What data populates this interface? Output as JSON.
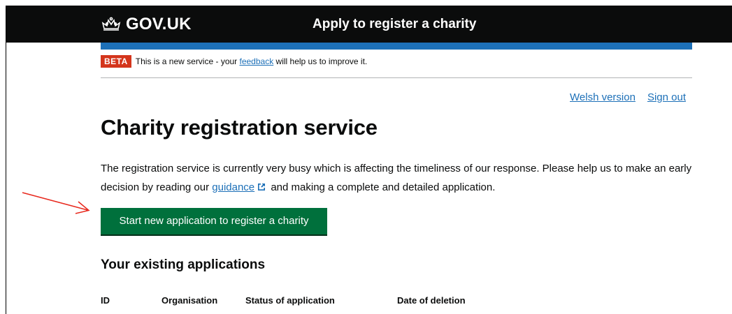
{
  "header": {
    "logo_text": "GOV.UK",
    "service_name": "Apply to register a charity",
    "background_color": "#0b0c0c",
    "accent_color": "#1d70b8"
  },
  "phase_banner": {
    "tag": "BETA",
    "text_before": "This is a new service - your ",
    "link_text": "feedback",
    "text_after": " will help us to improve it.",
    "tag_color": "#d4351c"
  },
  "top_links": {
    "welsh": "Welsh version",
    "sign_out": "Sign out"
  },
  "main": {
    "title": "Charity registration service",
    "intro_part1": "The registration service is currently very busy which is affecting the timeliness of our response. Please help us to make an early decision by reading our ",
    "intro_link": "guidance",
    "intro_link_icon": "external-link-icon",
    "intro_part2": " and making a complete and detailed application.",
    "start_button": "Start new application to register a charity",
    "start_button_color": "#00703c"
  },
  "existing": {
    "title": "Your existing applications",
    "columns": [
      "ID",
      "Organisation",
      "Status of application",
      "Date of deletion"
    ]
  },
  "annotation": {
    "arrow_color": "#e8281d"
  }
}
